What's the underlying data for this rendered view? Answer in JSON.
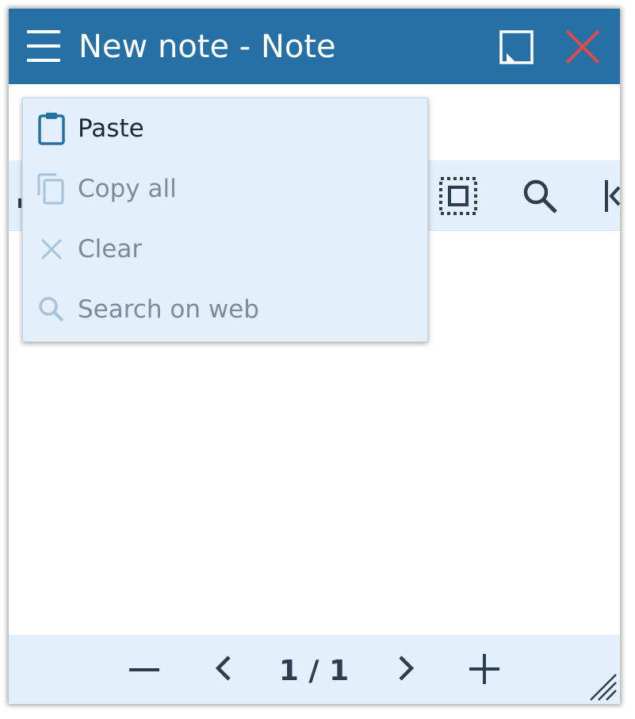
{
  "window": {
    "title": "New note - Note",
    "titlebar_color": "#2670a6",
    "close_color": "#e04a4a"
  },
  "titlebar": {
    "menu_icon": "hamburger-icon",
    "maximize_icon": "maximize-icon",
    "close_icon": "close-icon"
  },
  "toolbar": {
    "background": "#e3f0fc",
    "visible_icons": [
      "select-all-icon",
      "search-icon",
      "jump-to-start-icon"
    ]
  },
  "context_menu": {
    "items": [
      {
        "label": "Paste",
        "icon": "clipboard-icon",
        "enabled": true
      },
      {
        "label": "Copy all",
        "icon": "copy-icon",
        "enabled": false
      },
      {
        "label": "Clear",
        "icon": "clear-icon",
        "enabled": false
      },
      {
        "label": "Search on web",
        "icon": "search-icon",
        "enabled": false
      }
    ]
  },
  "footer": {
    "page_indicator": "1 / 1",
    "zoom_out_icon": "minus-icon",
    "prev_icon": "chevron-left-icon",
    "next_icon": "chevron-right-icon",
    "zoom_in_icon": "plus-icon",
    "resize_icon": "resize-grip-icon"
  }
}
